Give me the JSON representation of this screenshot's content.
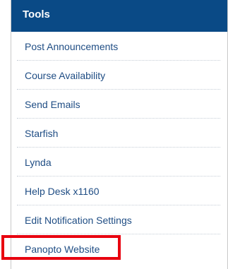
{
  "tools_panel": {
    "title": "Tools",
    "items": [
      {
        "label": "Post Announcements"
      },
      {
        "label": "Course Availability"
      },
      {
        "label": "Send Emails"
      },
      {
        "label": "Starfish"
      },
      {
        "label": "Lynda"
      },
      {
        "label": "Help Desk x1160"
      },
      {
        "label": "Edit Notification Settings"
      },
      {
        "label": "Panopto Website"
      }
    ]
  },
  "colors": {
    "header_background": "#0a4a86",
    "link_text": "#1f4d84",
    "highlight_border": "#e8000f"
  }
}
